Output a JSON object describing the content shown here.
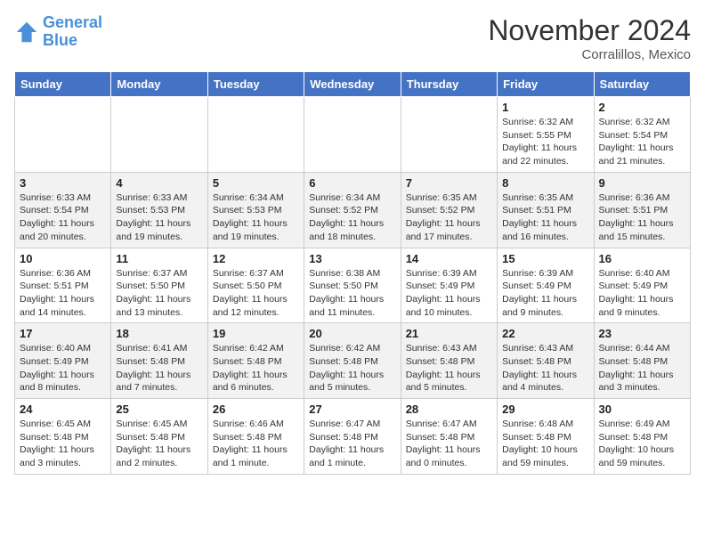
{
  "logo": {
    "line1": "General",
    "line2": "Blue"
  },
  "title": "November 2024",
  "location": "Corralillos, Mexico",
  "weekdays": [
    "Sunday",
    "Monday",
    "Tuesday",
    "Wednesday",
    "Thursday",
    "Friday",
    "Saturday"
  ],
  "weeks": [
    [
      {
        "day": "",
        "info": ""
      },
      {
        "day": "",
        "info": ""
      },
      {
        "day": "",
        "info": ""
      },
      {
        "day": "",
        "info": ""
      },
      {
        "day": "",
        "info": ""
      },
      {
        "day": "1",
        "info": "Sunrise: 6:32 AM\nSunset: 5:55 PM\nDaylight: 11 hours and 22 minutes."
      },
      {
        "day": "2",
        "info": "Sunrise: 6:32 AM\nSunset: 5:54 PM\nDaylight: 11 hours and 21 minutes."
      }
    ],
    [
      {
        "day": "3",
        "info": "Sunrise: 6:33 AM\nSunset: 5:54 PM\nDaylight: 11 hours and 20 minutes."
      },
      {
        "day": "4",
        "info": "Sunrise: 6:33 AM\nSunset: 5:53 PM\nDaylight: 11 hours and 19 minutes."
      },
      {
        "day": "5",
        "info": "Sunrise: 6:34 AM\nSunset: 5:53 PM\nDaylight: 11 hours and 19 minutes."
      },
      {
        "day": "6",
        "info": "Sunrise: 6:34 AM\nSunset: 5:52 PM\nDaylight: 11 hours and 18 minutes."
      },
      {
        "day": "7",
        "info": "Sunrise: 6:35 AM\nSunset: 5:52 PM\nDaylight: 11 hours and 17 minutes."
      },
      {
        "day": "8",
        "info": "Sunrise: 6:35 AM\nSunset: 5:51 PM\nDaylight: 11 hours and 16 minutes."
      },
      {
        "day": "9",
        "info": "Sunrise: 6:36 AM\nSunset: 5:51 PM\nDaylight: 11 hours and 15 minutes."
      }
    ],
    [
      {
        "day": "10",
        "info": "Sunrise: 6:36 AM\nSunset: 5:51 PM\nDaylight: 11 hours and 14 minutes."
      },
      {
        "day": "11",
        "info": "Sunrise: 6:37 AM\nSunset: 5:50 PM\nDaylight: 11 hours and 13 minutes."
      },
      {
        "day": "12",
        "info": "Sunrise: 6:37 AM\nSunset: 5:50 PM\nDaylight: 11 hours and 12 minutes."
      },
      {
        "day": "13",
        "info": "Sunrise: 6:38 AM\nSunset: 5:50 PM\nDaylight: 11 hours and 11 minutes."
      },
      {
        "day": "14",
        "info": "Sunrise: 6:39 AM\nSunset: 5:49 PM\nDaylight: 11 hours and 10 minutes."
      },
      {
        "day": "15",
        "info": "Sunrise: 6:39 AM\nSunset: 5:49 PM\nDaylight: 11 hours and 9 minutes."
      },
      {
        "day": "16",
        "info": "Sunrise: 6:40 AM\nSunset: 5:49 PM\nDaylight: 11 hours and 9 minutes."
      }
    ],
    [
      {
        "day": "17",
        "info": "Sunrise: 6:40 AM\nSunset: 5:49 PM\nDaylight: 11 hours and 8 minutes."
      },
      {
        "day": "18",
        "info": "Sunrise: 6:41 AM\nSunset: 5:48 PM\nDaylight: 11 hours and 7 minutes."
      },
      {
        "day": "19",
        "info": "Sunrise: 6:42 AM\nSunset: 5:48 PM\nDaylight: 11 hours and 6 minutes."
      },
      {
        "day": "20",
        "info": "Sunrise: 6:42 AM\nSunset: 5:48 PM\nDaylight: 11 hours and 5 minutes."
      },
      {
        "day": "21",
        "info": "Sunrise: 6:43 AM\nSunset: 5:48 PM\nDaylight: 11 hours and 5 minutes."
      },
      {
        "day": "22",
        "info": "Sunrise: 6:43 AM\nSunset: 5:48 PM\nDaylight: 11 hours and 4 minutes."
      },
      {
        "day": "23",
        "info": "Sunrise: 6:44 AM\nSunset: 5:48 PM\nDaylight: 11 hours and 3 minutes."
      }
    ],
    [
      {
        "day": "24",
        "info": "Sunrise: 6:45 AM\nSunset: 5:48 PM\nDaylight: 11 hours and 3 minutes."
      },
      {
        "day": "25",
        "info": "Sunrise: 6:45 AM\nSunset: 5:48 PM\nDaylight: 11 hours and 2 minutes."
      },
      {
        "day": "26",
        "info": "Sunrise: 6:46 AM\nSunset: 5:48 PM\nDaylight: 11 hours and 1 minute."
      },
      {
        "day": "27",
        "info": "Sunrise: 6:47 AM\nSunset: 5:48 PM\nDaylight: 11 hours and 1 minute."
      },
      {
        "day": "28",
        "info": "Sunrise: 6:47 AM\nSunset: 5:48 PM\nDaylight: 11 hours and 0 minutes."
      },
      {
        "day": "29",
        "info": "Sunrise: 6:48 AM\nSunset: 5:48 PM\nDaylight: 10 hours and 59 minutes."
      },
      {
        "day": "30",
        "info": "Sunrise: 6:49 AM\nSunset: 5:48 PM\nDaylight: 10 hours and 59 minutes."
      }
    ]
  ]
}
